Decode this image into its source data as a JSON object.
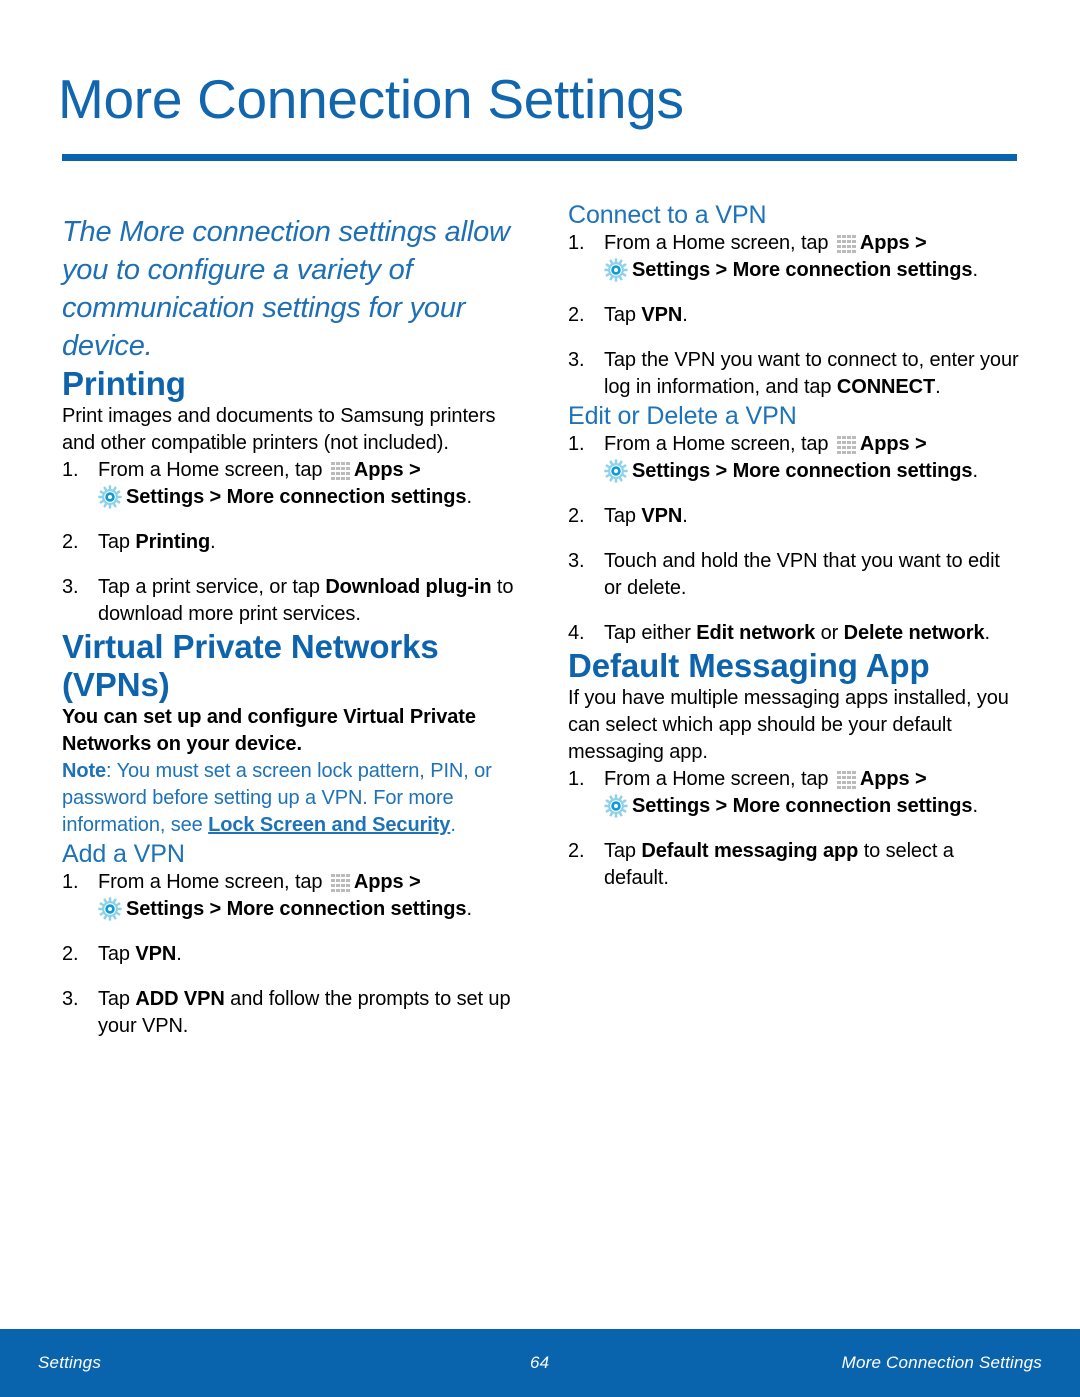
{
  "page": {
    "title": "More Connection Settings",
    "accent_blue": "#0A64AD",
    "heading_blue": "#0E64AC",
    "subhead_blue": "#1D72B8"
  },
  "intro": {
    "text": "The More connection settings allow you to configure a variety of communication settings for your device."
  },
  "icons": {
    "apps": "apps-grid-icon",
    "settings": "settings-gear-icon"
  },
  "left_column": {
    "printing": {
      "heading": "Printing",
      "body": "Print images and documents to Samsung printers and other compatible printers (not included).",
      "steps": [
        {
          "num": "1.",
          "pre": "From a Home screen, tap ",
          "apps_label": "Apps",
          "arrow1": " > ",
          "settings_label": "Settings > More connection settings",
          "post": "."
        },
        {
          "num": "2.",
          "pre": "Tap ",
          "bold": "Printing",
          "post": "."
        },
        {
          "num": "3.",
          "pre": "Tap a print service, or tap ",
          "bold": "Download plug-in",
          "post": " to download more print services."
        }
      ]
    },
    "vpn": {
      "heading": "Virtual Private Networks (VPNs)",
      "body": "You can set up and configure Virtual Private Networks on your device.",
      "note_label": "Note",
      "note_body": ": You must set a screen lock pattern, PIN, or password before setting up a VPN. For more information, see ",
      "note_link": "Lock Screen and Security",
      "note_end": "."
    },
    "add_vpn": {
      "heading": "Add a VPN",
      "steps": [
        {
          "num": "1.",
          "pre": "From a Home screen, tap ",
          "apps_label": "Apps",
          "arrow1": " > ",
          "settings_label": "Settings > More connection settings",
          "post": "."
        },
        {
          "num": "2.",
          "pre": "Tap ",
          "bold": "VPN",
          "post": "."
        },
        {
          "num": "3.",
          "pre": "Tap ",
          "bold": "ADD VPN",
          "post": " and follow the prompts to set up your VPN."
        }
      ]
    }
  },
  "right_column": {
    "connect_vpn": {
      "heading": "Connect to a VPN",
      "steps": [
        {
          "num": "1.",
          "pre": "From a Home screen, tap ",
          "apps_label": "Apps",
          "arrow1": " > ",
          "settings_label": "Settings > More connection settings",
          "post": "."
        },
        {
          "num": "2.",
          "pre": "Tap ",
          "bold": "VPN",
          "post": "."
        },
        {
          "num": "3.",
          "pre": "Tap the VPN you want to connect to, enter your log in information, and tap ",
          "bold": "CONNECT",
          "post": "."
        }
      ]
    },
    "edit_vpn": {
      "heading": "Edit or Delete a VPN",
      "steps": [
        {
          "num": "1.",
          "pre": "From a Home screen, tap ",
          "apps_label": "Apps",
          "arrow1": " > ",
          "settings_label": "Settings > More connection settings",
          "post": "."
        },
        {
          "num": "2.",
          "pre": "Tap ",
          "bold": "VPN",
          "post": "."
        },
        {
          "num": "3.",
          "pre": "Touch and hold the VPN that you want to edit or delete.",
          "bold": "",
          "post": ""
        },
        {
          "num": "4.",
          "pre": "Tap either ",
          "bold": "Edit network",
          "mid": " or ",
          "bold2": "Delete network",
          "post": "."
        }
      ]
    },
    "default_messaging": {
      "heading": "Default Messaging App",
      "body": "If you have multiple messaging apps installed, you can select which app should be your default messaging app.",
      "steps": [
        {
          "num": "1.",
          "pre": "From a Home screen, tap ",
          "apps_label": "Apps",
          "arrow1": " > ",
          "settings_label": "Settings > More connection settings",
          "post": "."
        },
        {
          "num": "2.",
          "pre": "Tap ",
          "bold": "Default messaging app",
          "post": " to select a default."
        }
      ]
    }
  },
  "footer": {
    "left": "Settings",
    "page_number": "64",
    "right": "More Connection Settings"
  }
}
